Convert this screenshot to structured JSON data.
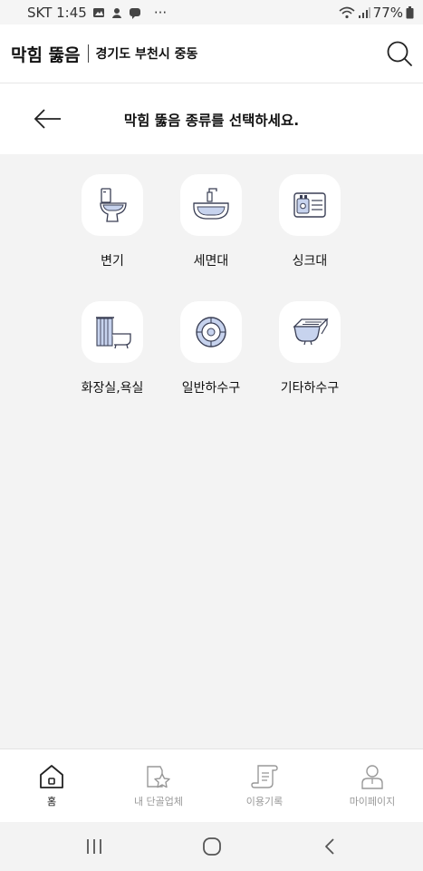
{
  "status": {
    "carrier_time": "SKT 1:45",
    "more": "···",
    "battery": "77%"
  },
  "appbar": {
    "title": "막힘 뚫음",
    "location": "경기도 부천시 중동"
  },
  "header": {
    "heading": "막힘 뚫음 종류를 선택하세요."
  },
  "categories": [
    {
      "label": "변기",
      "icon": "toilet-icon"
    },
    {
      "label": "세면대",
      "icon": "washbasin-icon"
    },
    {
      "label": "싱크대",
      "icon": "sink-icon"
    },
    {
      "label": "화장실,욕실",
      "icon": "bathtub-icon"
    },
    {
      "label": "일반하수구",
      "icon": "drain-icon"
    },
    {
      "label": "기타하수구",
      "icon": "gutter-icon"
    }
  ],
  "bottom_nav": [
    {
      "label": "홈",
      "icon": "home-icon",
      "active": true
    },
    {
      "label": "내 단골업체",
      "icon": "favorite-store-icon",
      "active": false
    },
    {
      "label": "이용기록",
      "icon": "history-scroll-icon",
      "active": false
    },
    {
      "label": "마이페이지",
      "icon": "person-icon",
      "active": false
    }
  ],
  "colors": {
    "background": "#f3f3f3",
    "surface": "#ffffff",
    "icon_blue": "#c7d3ee",
    "icon_stroke": "#3a3f55",
    "nav_inactive": "#999999"
  }
}
